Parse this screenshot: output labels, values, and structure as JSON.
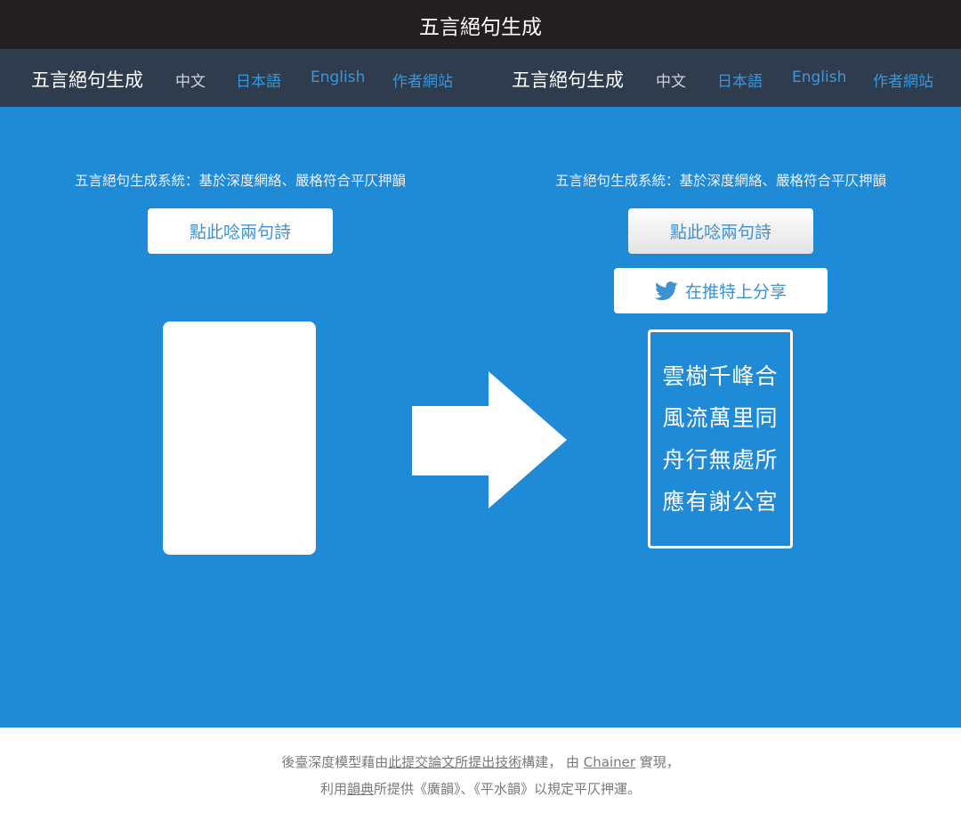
{
  "window": {
    "title": "五言絕句生成"
  },
  "nav": {
    "brand": "五言絕句生成",
    "links": [
      "中文",
      "日本語",
      "English",
      "作者網站"
    ]
  },
  "tagline": "五言絕句生成系統：基於深度網絡、嚴格符合平仄押韻",
  "generate_label": "點此唸兩句詩",
  "share_label": "在推特上分享",
  "poem": [
    "雲樹千峰合",
    "風流萬里同",
    "舟行無處所",
    "應有謝公宮"
  ],
  "footer": {
    "line1": {
      "pre": "後臺深度模型藉由",
      "paper_link": "此提交論文所提出技術",
      "mid": "構建，  由 ",
      "chainer_link": "Chainer",
      "post": " 實現，"
    },
    "line2": {
      "pre": "利用",
      "dict_link": "韻典",
      "post": "所提供《廣韻》、《平水韻》以規定平仄押運。"
    }
  },
  "icons": {
    "share": "twitter-bird-icon",
    "transition": "arrow-right-icon"
  },
  "colors": {
    "title_bar": "#231f20",
    "navbar": "#2f3c4e",
    "nav_link": "#3c96d8",
    "main_bg": "#1f8ad6",
    "button_text": "#3e92d0"
  }
}
